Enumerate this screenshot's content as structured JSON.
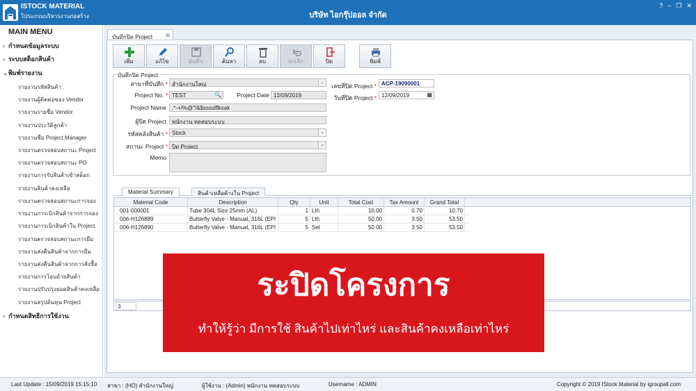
{
  "app": {
    "title": "ISTOCK MATERIAL",
    "subtitle": "โปรแกรมบริหารงานก่อสร้าง",
    "company": "บริษัท ไอกรุ๊ปออล จำกัด",
    "win_controls": [
      "?",
      "–",
      "❐",
      "✕"
    ]
  },
  "sidebar": {
    "title": "MAIN MENU",
    "top_items": [
      {
        "label": "กำหนดข้อมูลระบบ"
      },
      {
        "label": "ระบบสต็อกสินค้า"
      },
      {
        "label": "พิมพ์รายงาน"
      },
      {
        "label": "กำหนดสิทธิการใช้งาน"
      }
    ],
    "reports": [
      "รายงานรหัสสินค้า",
      "รายงานผู้ติดต่อของ Vendor",
      "รายงานรายชื่อ Vendor",
      "รายงานประวัติลูกค้า",
      "รายงานชื่อ Project Manager",
      "รายงานตรวจสอบสถานะ Project",
      "รายงานตรวจสอบสถานะ PO",
      "รายงานการรับสินค้าเข้าสต็อก",
      "รายงานสินค้าคงเหลือ",
      "รายงานตรวจสอบสถานะการจอง",
      "รายงานการเบิกสินค้าจากการจอง",
      "รายงานการเบิกสินค้าใน Project",
      "รายงานตรวจสอบสถานะการยืม",
      "รายงานส่งคืนสินค้าจากการยืม",
      "รายงานส่งคืนสินค้าจากการสั่งซื้อ",
      "รายงานการโอนย้ายสินค้า",
      "รายงานปรับปรุงยอดสินค้าคงเหลือ",
      "รายงานสรุปต้นทุน Project"
    ]
  },
  "doc_tab": {
    "label": "บันทึกปิด Project",
    "close": "⊠"
  },
  "toolbar": {
    "add": "เพิ่ม",
    "edit": "แก้ไข",
    "save": "บันทึก",
    "search": "ค้นหา",
    "delete": "ลบ",
    "cancel": "ยกเลิก",
    "close": "ปิด",
    "print": "พิมพ์"
  },
  "form": {
    "group_title": "บันทึกปิด Project",
    "branch_label": "สาขาที่บันทึก",
    "branch_value": "สำนักงานใหญ่",
    "project_no_label": "Project No.",
    "project_no_value": "TEST",
    "project_date_label": "Project Date",
    "project_date_value": "12/09/2019",
    "project_name_label": "Project Name",
    "project_name_value": ".*-+/%@\"!&$sssslflksak",
    "closer_label": "ผู้ปิด Project",
    "closer_value": "พนักงาน ทดสอบระบบ",
    "warehouse_label": "รหัสคลังสินค้า",
    "warehouse_value": "Stock",
    "status_label": "สถานะ Project",
    "status_value": "ปิด Project",
    "memo_label": "Memo",
    "memo_value": "",
    "close_no_label": "เลขที่ปิด Project",
    "close_no_value": "ACP-19090001",
    "close_date_label": "วันที่ปิด Project",
    "close_date_value": "12/09/2019",
    "required_mark": "*"
  },
  "subtabs": [
    "Material Summary",
    "สินค้าเหลือค้างใน Project"
  ],
  "grid": {
    "headers": [
      "Material Code",
      "Description",
      "Qty",
      "Unit",
      "Total Cost",
      "Tax Amount",
      "Grand Total"
    ],
    "rows": [
      {
        "code": "001-000001",
        "desc": "Tube 304L Size 25mm (AL)",
        "qty": "1",
        "unit": "Lth",
        "cost": "10.00",
        "tax": "0.70",
        "total": "10.70"
      },
      {
        "code": "006-H126889",
        "desc": "Butterfly Valve - Manual, 316L (EPI",
        "qty": "5",
        "unit": "Lth",
        "cost": "50.00",
        "tax": "3.50",
        "total": "53.50"
      },
      {
        "code": "006-H126890",
        "desc": "Butterfly Valve - Manual, 316L (EPI",
        "qty": "5",
        "unit": "Set",
        "cost": "50.00",
        "tax": "3.50",
        "total": "53.50"
      }
    ],
    "row_count": "3"
  },
  "overlay": {
    "title": "ระปิดโครงการ",
    "subtitle": "ทำให้รู้ว่า มีการใช้ สินค้าไปเท่าไหร่ และสินค้าคงเหลือเท่าไหร่",
    "color": "#d8171d"
  },
  "status": {
    "last_update": "Last Update : 15/09/2019 15:15:10",
    "branch": "สาขา : (HO) สำนักงานใหญ่",
    "user_th": "ผู้ใช้งาน : (Admin) พนักงาน ทดสอบระบบ",
    "username": "Username : ADMIN",
    "copyright": "Copyright © 2019 IStock Material by igroupall.com"
  }
}
